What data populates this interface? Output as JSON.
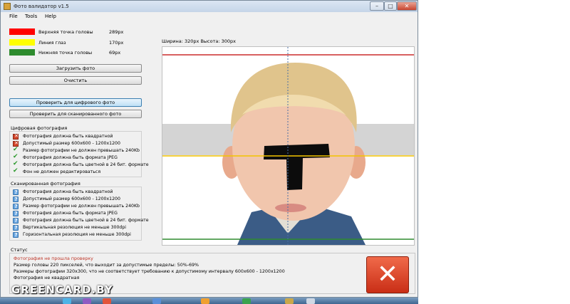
{
  "window": {
    "title": "Фото валидатор v1.5",
    "controls": {
      "minimize": "–",
      "maximize": "□",
      "close": "✕"
    }
  },
  "menu": [
    "File",
    "Tools",
    "Help"
  ],
  "legend": [
    {
      "color": "#ff0000",
      "label": "Верхняя точка головы",
      "value": "289px"
    },
    {
      "color": "#ffff00",
      "label": "Линия глаз",
      "value": "170px"
    },
    {
      "color": "#2e8b2e",
      "label": "Нижняя точка головы",
      "value": "69px"
    }
  ],
  "buttons": {
    "load": "Загрузить фото",
    "clear": "Очистить",
    "check_digital": "Проверить для цифрового фото",
    "check_scanned": "Проверить для сканированного фото"
  },
  "digital": {
    "title": "Цифровая фотография",
    "items": [
      {
        "icon": "error-icon",
        "text": "Фотография должна быть квадратной"
      },
      {
        "icon": "error-icon",
        "text": "Допустимый размер 600x600 - 1200x1200"
      },
      {
        "icon": "checkmark-icon",
        "text": "Размер фотографии не должен превышать 240Kb"
      },
      {
        "icon": "checkmark-icon",
        "text": "Фотография должна быть формата JPEG"
      },
      {
        "icon": "checkmark-icon",
        "text": "Фотография должна быть цветной в 24 бит. формате"
      },
      {
        "icon": "checkmark-icon",
        "text": "Фон не должен редактироваться"
      }
    ]
  },
  "scanned": {
    "title": "Сканированная фотография",
    "items": [
      {
        "icon": "question-icon",
        "text": "Фотография должна быть квадратной"
      },
      {
        "icon": "question-icon",
        "text": "Допустимый размер 600x600 - 1200x1200"
      },
      {
        "icon": "question-icon",
        "text": "Размер фотографии не должен превышать 240Kb"
      },
      {
        "icon": "question-icon",
        "text": "Фотография должна быть формата JPEG"
      },
      {
        "icon": "question-icon",
        "text": "Фотография должна быть цветной в 24 бит. формате"
      },
      {
        "icon": "question-icon",
        "text": "Вертикальная резолюция не меньше 300dpi"
      },
      {
        "icon": "question-icon",
        "text": "Горизонтальная резолюция не меньше 300dpi"
      }
    ]
  },
  "photo": {
    "dimensions": "Ширина: 320px   Высота: 300px",
    "line_colors": {
      "top": "#cc2b2b",
      "eyes": "#f3c400",
      "bottom": "#2e8b2e",
      "center": "#4a6fa5"
    }
  },
  "status": {
    "label": "Статус",
    "error_title": "Фотография не прошла проверку",
    "lines": [
      "Размер головы 220 пикселей, что выходит за допустимые пределы: 50%-69%",
      "Размеры фотографии 320x300, что не соответствует требованию к допустимому интервалу 600x600 - 1200x1200",
      "Фотография не квадратная"
    ],
    "result_icon": "fail-x-icon"
  },
  "watermark": "GREENCARD.BY"
}
